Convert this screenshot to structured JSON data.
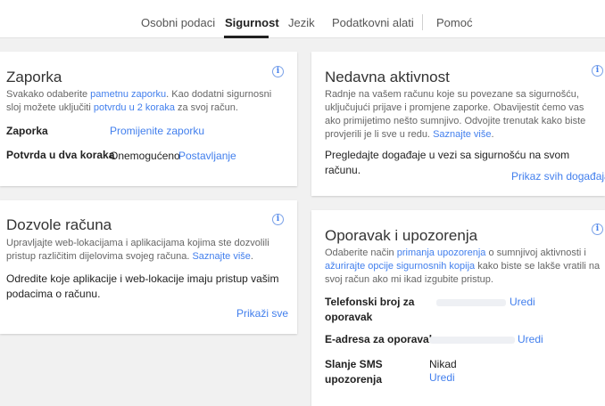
{
  "nav": {
    "tabs": [
      {
        "label": "Osobni podaci"
      },
      {
        "label": "Sigurnost"
      },
      {
        "label": "Jezik"
      },
      {
        "label": "Podatkovni alati"
      },
      {
        "label": "Pomoć"
      }
    ],
    "active_tab": "Sigurnost"
  },
  "password_card": {
    "title": "Zaporka",
    "desc_part1": "Svakako odaberite ",
    "desc_link1": "pametnu zaporku",
    "desc_part2": ". Kao dodatni sigurnosni sloj možete uključiti ",
    "desc_link2": "potvrdu u 2 koraka",
    "desc_part3": " za svoj račun.",
    "rows": [
      {
        "label": "Zaporka",
        "value": "",
        "link": "Promijenite zaporku"
      },
      {
        "label": "Potvrda u dva koraka",
        "value": "Onemogućeno",
        "link": "Postavljanje"
      }
    ]
  },
  "activity_card": {
    "title": "Nedavna aktivnost",
    "desc_text": "Radnje na vašem računu koje su povezane sa sigurnošću, uključujući prijave i promjene zaporke. Obavijestit ćemo vas ako primijetimo nešto sumnjivo. Odvojite trenutak kako biste provjerili je li sve u redu. ",
    "desc_link": "Saznajte više",
    "desc_end": ".",
    "body": "Pregledajte događaje u vezi sa sigurnošću na svom računu.",
    "action": "Prikaz svih događaja"
  },
  "permissions_card": {
    "title": "Dozvole računa",
    "desc_text": "Upravljajte web-lokacijama i aplikacijama kojima ste dozvolili pristup različitim dijelovima svojeg računa. ",
    "desc_link": "Saznajte više",
    "desc_end": ".",
    "body": "Odredite koje aplikacije i web-lokacije imaju pristup vašim podacima o računu.",
    "action": "Prikaži sve"
  },
  "recovery_card": {
    "title": "Oporavak i upozorenja",
    "desc_part1": "Odaberite način ",
    "desc_link1": "primanja upozorenja",
    "desc_part2": " o sumnjivoj aktivnosti i ",
    "desc_link2": "ažurirajte opcije sigurnosnih kopija",
    "desc_part3": " kako biste se lakše vratili na svoj račun ako mi ikad izgubite pristup.",
    "rows": [
      {
        "label": "Telefonski broj za oporavak",
        "value": "",
        "link": "Uredi"
      },
      {
        "label": "E-adresa za oporavak",
        "value": "",
        "link": "Uredi"
      },
      {
        "label": "Slanje SMS upozorenja",
        "value": "Nikad",
        "link": "Uredi"
      }
    ]
  },
  "icons": {
    "info": "info-icon"
  },
  "colors": {
    "link": "#427fed",
    "background": "#f1f1f1"
  }
}
